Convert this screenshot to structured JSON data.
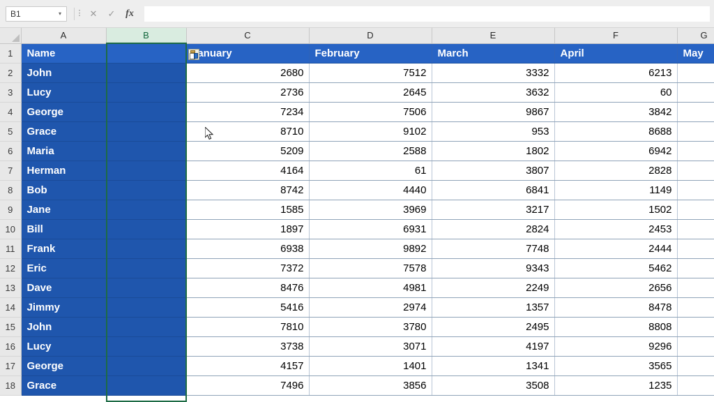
{
  "app": {
    "name_box_value": "B1",
    "name_box_caret": "▾",
    "dots_icon": "⋮",
    "cancel_icon": "✕",
    "confirm_icon": "✓",
    "function_icon": "fx",
    "formula_value": ""
  },
  "grid": {
    "corner_label": "",
    "column_headers": [
      "A",
      "B",
      "C",
      "D",
      "E",
      "F",
      "G"
    ],
    "selected_column": "B",
    "row_numbers": [
      "1",
      "2",
      "3",
      "4",
      "5",
      "6",
      "7",
      "8",
      "9",
      "10",
      "11",
      "12",
      "13",
      "14",
      "15",
      "16",
      "17",
      "18"
    ],
    "paste_badge_icon": "paste-icon"
  },
  "colors": {
    "header_blue": "#2763c4",
    "body_blue": "#1f56ad",
    "selection_green": "#1d6b45",
    "header_fill": "#e8e8e8"
  },
  "table": {
    "headers": [
      "Name",
      "",
      "January",
      "February",
      "March",
      "April",
      "May"
    ],
    "rows": [
      {
        "name": "John",
        "b": "",
        "january": "2680",
        "february": "7512",
        "march": "3332",
        "april": "6213",
        "may": ""
      },
      {
        "name": "Lucy",
        "b": "",
        "january": "2736",
        "february": "2645",
        "march": "3632",
        "april": "60",
        "may": ""
      },
      {
        "name": "George",
        "b": "",
        "january": "7234",
        "february": "7506",
        "march": "9867",
        "april": "3842",
        "may": ""
      },
      {
        "name": "Grace",
        "b": "",
        "january": "8710",
        "february": "9102",
        "march": "953",
        "april": "8688",
        "may": ""
      },
      {
        "name": "Maria",
        "b": "",
        "january": "5209",
        "february": "2588",
        "march": "1802",
        "april": "6942",
        "may": ""
      },
      {
        "name": "Herman",
        "b": "",
        "january": "4164",
        "february": "61",
        "march": "3807",
        "april": "2828",
        "may": ""
      },
      {
        "name": "Bob",
        "b": "",
        "january": "8742",
        "february": "4440",
        "march": "6841",
        "april": "1149",
        "may": ""
      },
      {
        "name": "Jane",
        "b": "",
        "january": "1585",
        "february": "3969",
        "march": "3217",
        "april": "1502",
        "may": ""
      },
      {
        "name": "Bill",
        "b": "",
        "january": "1897",
        "february": "6931",
        "march": "2824",
        "april": "2453",
        "may": ""
      },
      {
        "name": "Frank",
        "b": "",
        "january": "6938",
        "february": "9892",
        "march": "7748",
        "april": "2444",
        "may": ""
      },
      {
        "name": "Eric",
        "b": "",
        "january": "7372",
        "february": "7578",
        "march": "9343",
        "april": "5462",
        "may": ""
      },
      {
        "name": "Dave",
        "b": "",
        "january": "8476",
        "february": "4981",
        "march": "2249",
        "april": "2656",
        "may": ""
      },
      {
        "name": "Jimmy",
        "b": "",
        "january": "5416",
        "february": "2974",
        "march": "1357",
        "april": "8478",
        "may": ""
      },
      {
        "name": "John",
        "b": "",
        "january": "7810",
        "february": "3780",
        "march": "2495",
        "april": "8808",
        "may": ""
      },
      {
        "name": "Lucy",
        "b": "",
        "january": "3738",
        "february": "3071",
        "march": "4197",
        "april": "9296",
        "may": ""
      },
      {
        "name": "George",
        "b": "",
        "january": "4157",
        "february": "1401",
        "march": "1341",
        "april": "3565",
        "may": ""
      },
      {
        "name": "Grace",
        "b": "",
        "january": "7496",
        "february": "3856",
        "march": "3508",
        "april": "1235",
        "may": ""
      }
    ]
  }
}
